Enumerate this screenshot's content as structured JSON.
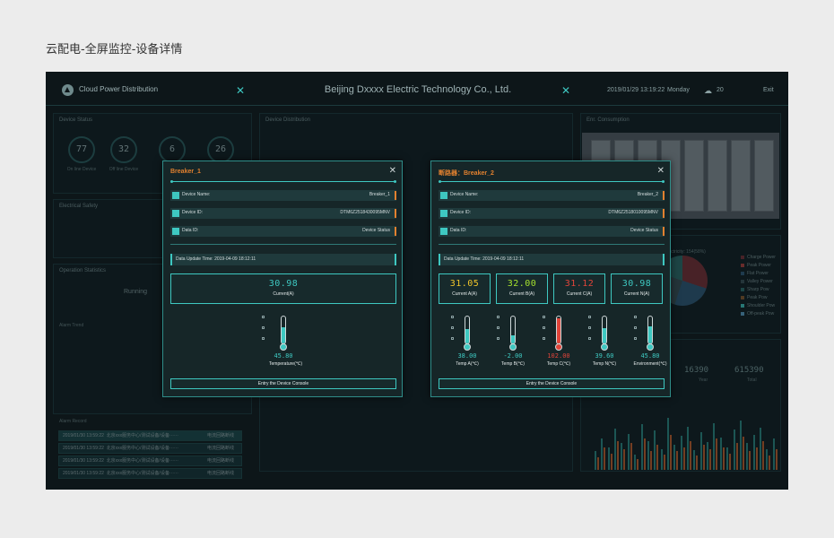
{
  "page_caption": "云配电-全屏监控-设备详情",
  "header": {
    "app_name": "Cloud Power Distribution",
    "company": "Beijing Dxxxx Electric Technology Co., Ltd.",
    "datetime": "2019/01/29 13:19:22",
    "weekday": "Monday",
    "temperature": "20",
    "exit_label": "Exit",
    "accent": "#3ec8c1"
  },
  "background": {
    "device_status": {
      "title": "Device Status",
      "gauges": [
        {
          "value": "77",
          "label": "On line Device"
        },
        {
          "value": "32",
          "label": "Off line Device"
        },
        {
          "value": "6",
          "label": ""
        },
        {
          "value": "26",
          "label": ""
        }
      ]
    },
    "device_distribution_title": "Device Distribution",
    "energy_title": "Enr. Consumption",
    "electrical_safety_title": "Electrical Safety",
    "operation_statistics_title": "Operation Statistics",
    "running_label": "Running",
    "alarm_trend_title": "Alarm Trend",
    "alarm_record_title": "Alarm Record",
    "alarm_rows": [
      {
        "time": "2019/01/30 13:59:22",
        "text": "北京xxx服务中心/测试设备/设备······",
        "status": "电流回路断线"
      },
      {
        "time": "2019/01/30 13:59:22",
        "text": "北京xxx服务中心/测试设备/设备······",
        "status": "电流回路断线"
      },
      {
        "time": "2019/01/30 13:59:22",
        "text": "北京xxx服务中心/测试设备/设备······",
        "status": "电流回路断线"
      },
      {
        "time": "2019/01/30 13:59:22",
        "text": "北京xxx服务中心/测试设备/设备······",
        "status": "电流回路断线"
      }
    ],
    "electricity_label": "Electricity: 154(58%)",
    "legend": [
      "Charge Power",
      "Peak Power",
      "Flat Power",
      "Valley Power",
      "Sharp Pow",
      "Peak Pow",
      "Shoulder Pow",
      "Off-peak Pow"
    ],
    "legend_colors": [
      "#7a2f33",
      "#b2413b",
      "#2e5a78",
      "#3a4f54",
      "#2c6e6a",
      "#8a5a2a",
      "#3ec8c1",
      "#5aa0c8"
    ],
    "year_total": {
      "year_value": "16390",
      "year_label": "Year",
      "total_value": "615390",
      "total_label": "Total"
    },
    "bar_series": [
      18,
      30,
      22,
      40,
      26,
      35,
      15,
      44,
      28,
      38,
      20,
      50,
      24,
      33,
      42,
      19,
      36,
      27,
      45,
      31,
      22,
      39,
      48,
      26,
      34,
      41,
      20,
      30
    ],
    "bar_series2": [
      12,
      22,
      16,
      28,
      20,
      26,
      10,
      30,
      18,
      24,
      15,
      34,
      18,
      22,
      28,
      14,
      24,
      20,
      30,
      22,
      16,
      26,
      32,
      18,
      22,
      28,
      14,
      20
    ]
  },
  "modal1": {
    "title": "Breaker_1",
    "close_icon": "close-icon",
    "rows": [
      {
        "label": "Device Name:",
        "value": "Breaker_1"
      },
      {
        "label": "Device ID:",
        "value": "DTM6Z2518430095MNV"
      },
      {
        "label": "Data ID:",
        "value": "Device Status"
      }
    ],
    "update": "Data Update Time:  2019-04-09 18:12:11",
    "metric": {
      "value": "30.98",
      "label": "Current(A)",
      "color": "#3ec8c1"
    },
    "therm": {
      "value": "45.80",
      "label": "Temperature(℃)",
      "level": 0.6,
      "color": "#3ec8c1"
    },
    "console": "Entry the Device Console"
  },
  "modal2": {
    "title": "断路器：Breaker_2",
    "close_icon": "close-icon",
    "rows": [
      {
        "label": "Device Name:",
        "value": "Breaker_2"
      },
      {
        "label": "Device ID:",
        "value": "DTM6Z2518010095MNV"
      },
      {
        "label": "Data ID:",
        "value": "Device Status"
      }
    ],
    "update": "Data Update Time:  2019-04-09 18:12:11",
    "metrics": [
      {
        "value": "31.05",
        "label": "Current A(A)",
        "color": "#f0c52a"
      },
      {
        "value": "32.00",
        "label": "Current B(A)",
        "color": "#a6e22e"
      },
      {
        "value": "31.12",
        "label": "Current C(A)",
        "color": "#e0443a"
      },
      {
        "value": "30.98",
        "label": "Current N(A)",
        "color": "#3ec8c1"
      }
    ],
    "therms": [
      {
        "value": "38.00",
        "label": "Temp A(℃)",
        "level": 0.55,
        "color": "#3ec8c1"
      },
      {
        "value": "-2.00",
        "label": "Temp B(℃)",
        "level": 0.3,
        "color": "#3ec8c1"
      },
      {
        "value": "102.00",
        "label": "Temp C(℃)",
        "level": 0.95,
        "color": "#e0443a"
      },
      {
        "value": "39.60",
        "label": "Temp N(℃)",
        "level": 0.58,
        "color": "#3ec8c1"
      },
      {
        "value": "45.80",
        "label": "Environment(℃)",
        "level": 0.62,
        "color": "#3ec8c1"
      }
    ],
    "console": "Entry the Device Console"
  }
}
